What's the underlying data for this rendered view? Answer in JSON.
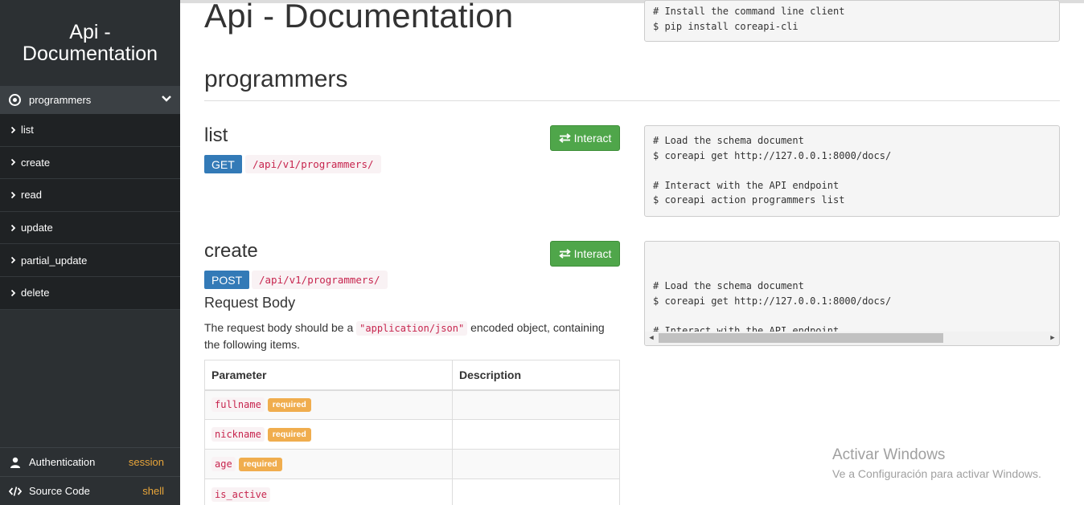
{
  "sidebar": {
    "brand": "Api - Documentation",
    "section": "programmers",
    "items": [
      {
        "label": "list"
      },
      {
        "label": "create"
      },
      {
        "label": "read"
      },
      {
        "label": "update"
      },
      {
        "label": "partial_update"
      },
      {
        "label": "delete"
      }
    ],
    "footer": {
      "auth_label": "Authentication",
      "auth_value": "session",
      "source_label": "Source Code",
      "source_value": "shell"
    }
  },
  "main": {
    "title": "Api - Documentation",
    "install_code": "# Install the command line client\n$ pip install coreapi-cli",
    "section_title": "programmers",
    "endpoints": [
      {
        "name": "list",
        "method": "GET",
        "path": "/api/v1/programmers/",
        "interact_label": "Interact",
        "code": "# Load the schema document\n$ coreapi get http://127.0.0.1:8000/docs/\n\n# Interact with the API endpoint\n$ coreapi action programmers list"
      },
      {
        "name": "create",
        "method": "POST",
        "path": "/api/v1/programmers/",
        "interact_label": "Interact",
        "code": "# Load the schema document\n$ coreapi get http://127.0.0.1:8000/docs/\n\n# Interact with the API endpoint\n$ coreapi action programmers create -p fullname=... -p nickname=... -p",
        "request_body_title": "Request Body",
        "request_desc_pre": "The request body should be a",
        "request_desc_code": "\"application/json\"",
        "request_desc_post": "encoded object, containing the following items.",
        "table": {
          "headers": [
            "Parameter",
            "Description"
          ],
          "rows": [
            {
              "name": "fullname",
              "required": "required",
              "description": ""
            },
            {
              "name": "nickname",
              "required": "required",
              "description": ""
            },
            {
              "name": "age",
              "required": "required",
              "description": ""
            },
            {
              "name": "is_active",
              "required": "",
              "description": ""
            }
          ]
        }
      }
    ]
  },
  "watermark": {
    "line1": "Activar Windows",
    "line2": "Ve a Configuración para activar Windows."
  }
}
